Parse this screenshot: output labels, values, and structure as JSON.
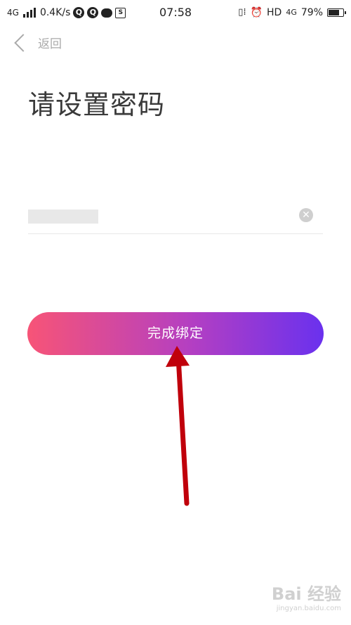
{
  "status_bar": {
    "network": "4G",
    "speed": "0.4K/s",
    "time": "07:58",
    "hd": "HD",
    "network_right": "4G",
    "battery_text": "79%",
    "battery_level": 0.79
  },
  "nav": {
    "back_label": "返回"
  },
  "page": {
    "title": "请设置密码"
  },
  "password": {
    "value": "",
    "placeholder": ""
  },
  "primary_button": {
    "label": "完成绑定"
  },
  "watermark": {
    "brand": "Bai 经验",
    "url": "jingyan.baidu.com"
  },
  "colors": {
    "gradient_start": "#f75477",
    "gradient_mid": "#b43fc2",
    "gradient_end": "#6a31ee",
    "arrow": "#c0000b"
  }
}
